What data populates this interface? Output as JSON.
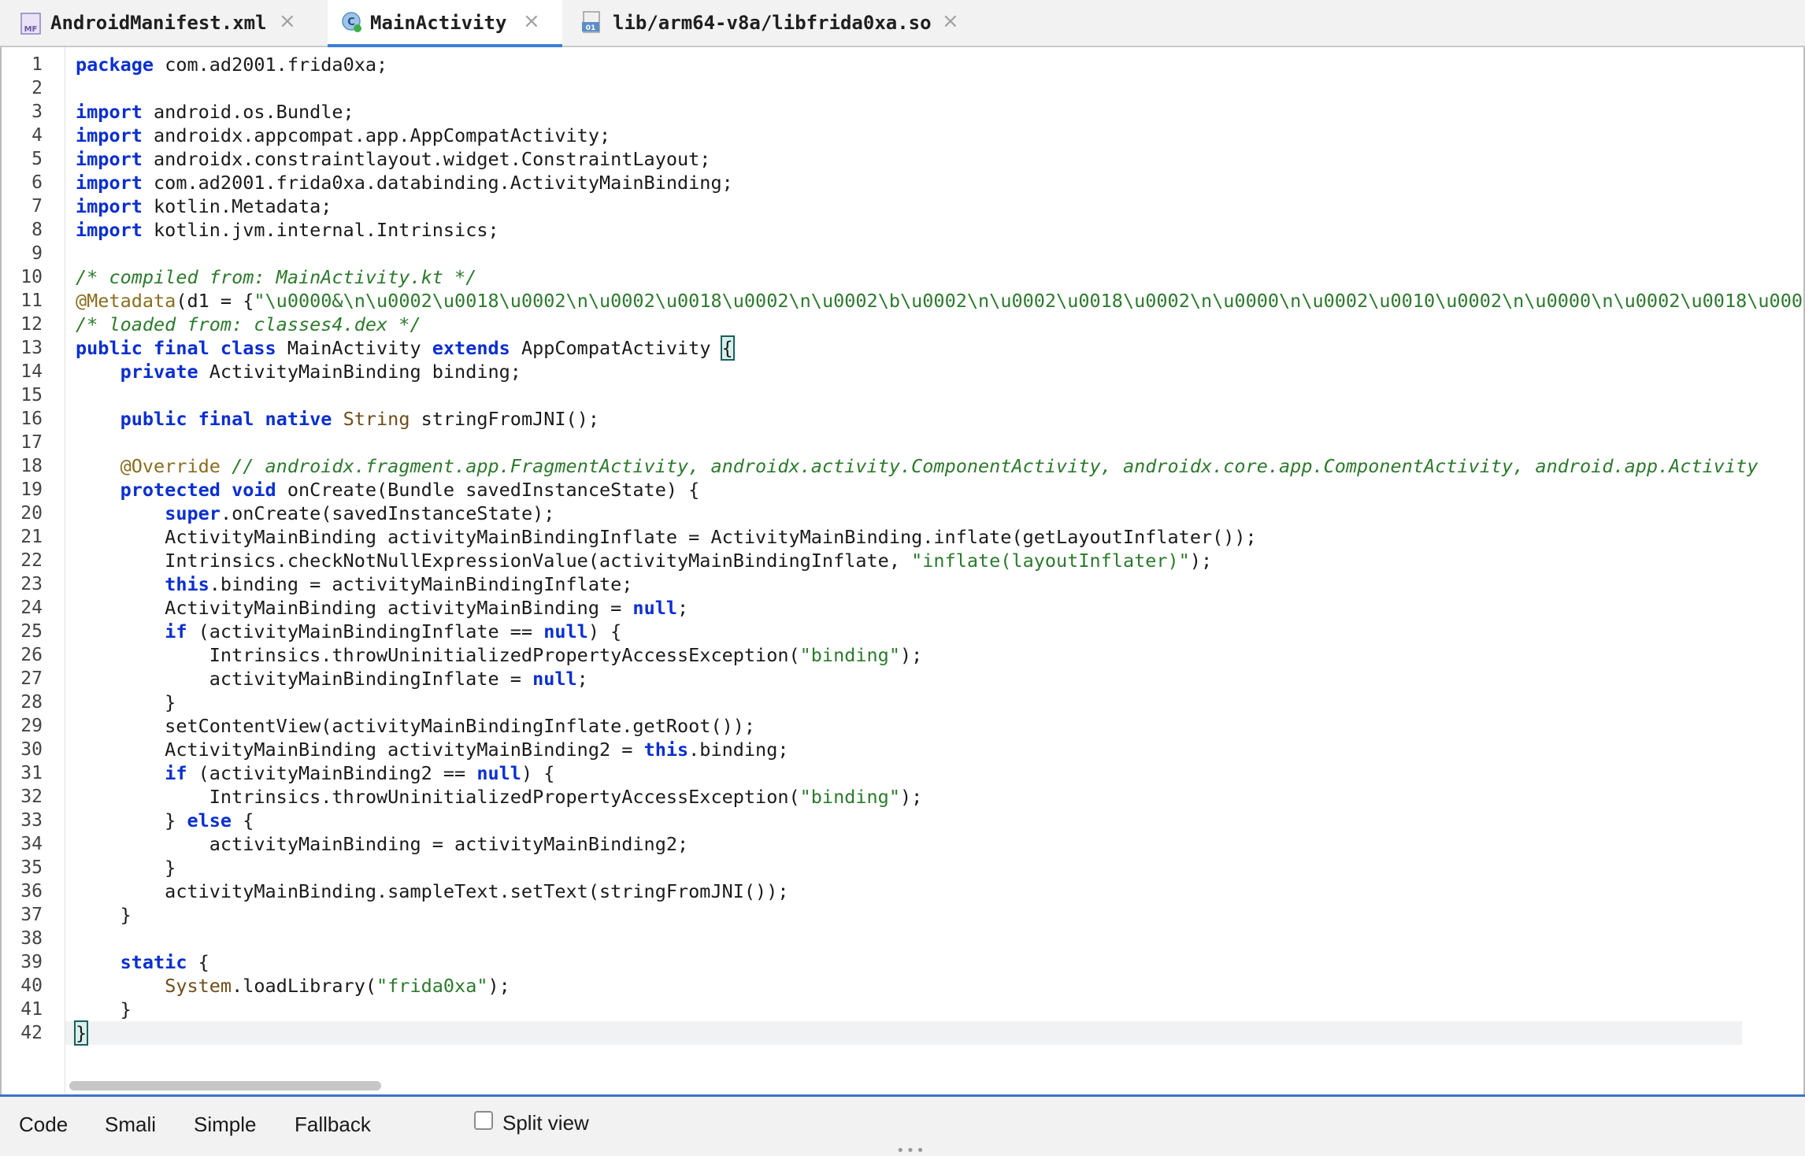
{
  "tabs": [
    {
      "label": "AndroidManifest.xml",
      "icon": "manifest-file-icon",
      "icon_text": "MF",
      "active": false
    },
    {
      "label": "MainActivity",
      "icon": "java-class-icon",
      "icon_text": "C",
      "active": true
    },
    {
      "label": "lib/arm64-v8a/libfrida0xa.so",
      "icon": "binary-file-icon",
      "icon_text": "01",
      "active": false
    }
  ],
  "close_glyph": "×",
  "line_numbers": [
    "1",
    "2",
    "3",
    "4",
    "5",
    "6",
    "7",
    "8",
    "9",
    "10",
    "11",
    "12",
    "13",
    "14",
    "15",
    "16",
    "17",
    "18",
    "19",
    "20",
    "21",
    "22",
    "23",
    "24",
    "25",
    "26",
    "27",
    "28",
    "29",
    "30",
    "31",
    "32",
    "33",
    "34",
    "35",
    "36",
    "37",
    "38",
    "39",
    "40",
    "41",
    "42"
  ],
  "code": [
    [
      {
        "t": "kw",
        "v": "package"
      },
      {
        "t": "p",
        "v": " com.ad2001.frida0xa;"
      }
    ],
    [],
    [
      {
        "t": "kw",
        "v": "import"
      },
      {
        "t": "p",
        "v": " android.os.Bundle;"
      }
    ],
    [
      {
        "t": "kw",
        "v": "import"
      },
      {
        "t": "p",
        "v": " androidx.appcompat.app.AppCompatActivity;"
      }
    ],
    [
      {
        "t": "kw",
        "v": "import"
      },
      {
        "t": "p",
        "v": " androidx.constraintlayout.widget.ConstraintLayout;"
      }
    ],
    [
      {
        "t": "kw",
        "v": "import"
      },
      {
        "t": "p",
        "v": " com.ad2001.frida0xa.databinding.ActivityMainBinding;"
      }
    ],
    [
      {
        "t": "kw",
        "v": "import"
      },
      {
        "t": "p",
        "v": " kotlin.Metadata;"
      }
    ],
    [
      {
        "t": "kw",
        "v": "import"
      },
      {
        "t": "p",
        "v": " kotlin.jvm.internal.Intrinsics;"
      }
    ],
    [],
    [
      {
        "t": "cm",
        "v": "/* compiled from: MainActivity.kt */"
      }
    ],
    [
      {
        "t": "ann",
        "v": "@Metadata"
      },
      {
        "t": "p",
        "v": "(d1 = {"
      },
      {
        "t": "str",
        "v": "\"\\u0000&\\n\\u0002\\u0018\\u0002\\n\\u0002\\u0018\\u0002\\n\\u0002\\b\\u0002\\n\\u0002\\u0018\\u0002\\n\\u0000\\n\\u0002\\u0010\\u0002\\n\\u0000\\n\\u0002\\u0018\\u0002\\n"
      }
    ],
    [
      {
        "t": "cm",
        "v": "/* loaded from: classes4.dex */"
      }
    ],
    [
      {
        "t": "kw",
        "v": "public final class"
      },
      {
        "t": "p",
        "v": " MainActivity "
      },
      {
        "t": "kw",
        "v": "extends"
      },
      {
        "t": "p",
        "v": " AppCompatActivity "
      },
      {
        "t": "hl",
        "v": "{"
      }
    ],
    [
      {
        "t": "p",
        "v": "    "
      },
      {
        "t": "kw",
        "v": "private"
      },
      {
        "t": "p",
        "v": " ActivityMainBinding binding;"
      }
    ],
    [],
    [
      {
        "t": "p",
        "v": "    "
      },
      {
        "t": "kw",
        "v": "public final native"
      },
      {
        "t": "p",
        "v": " "
      },
      {
        "t": "typ",
        "v": "String"
      },
      {
        "t": "p",
        "v": " stringFromJNI();"
      }
    ],
    [],
    [
      {
        "t": "p",
        "v": "    "
      },
      {
        "t": "ann",
        "v": "@Override"
      },
      {
        "t": "p",
        "v": " "
      },
      {
        "t": "cm",
        "v": "// androidx.fragment.app.FragmentActivity, androidx.activity.ComponentActivity, androidx.core.app.ComponentActivity, android.app.Activity"
      }
    ],
    [
      {
        "t": "p",
        "v": "    "
      },
      {
        "t": "kw",
        "v": "protected void"
      },
      {
        "t": "p",
        "v": " onCreate(Bundle savedInstanceState) {"
      }
    ],
    [
      {
        "t": "p",
        "v": "        "
      },
      {
        "t": "kw",
        "v": "super"
      },
      {
        "t": "p",
        "v": ".onCreate(savedInstanceState);"
      }
    ],
    [
      {
        "t": "p",
        "v": "        ActivityMainBinding activityMainBindingInflate = ActivityMainBinding.inflate(getLayoutInflater());"
      }
    ],
    [
      {
        "t": "p",
        "v": "        Intrinsics.checkNotNullExpressionValue(activityMainBindingInflate, "
      },
      {
        "t": "str",
        "v": "\"inflate(layoutInflater)\""
      },
      {
        "t": "p",
        "v": ");"
      }
    ],
    [
      {
        "t": "p",
        "v": "        "
      },
      {
        "t": "kw",
        "v": "this"
      },
      {
        "t": "p",
        "v": ".binding = activityMainBindingInflate;"
      }
    ],
    [
      {
        "t": "p",
        "v": "        ActivityMainBinding activityMainBinding = "
      },
      {
        "t": "kw",
        "v": "null"
      },
      {
        "t": "p",
        "v": ";"
      }
    ],
    [
      {
        "t": "p",
        "v": "        "
      },
      {
        "t": "kw",
        "v": "if"
      },
      {
        "t": "p",
        "v": " (activityMainBindingInflate == "
      },
      {
        "t": "kw",
        "v": "null"
      },
      {
        "t": "p",
        "v": ") {"
      }
    ],
    [
      {
        "t": "p",
        "v": "            Intrinsics.throwUninitializedPropertyAccessException("
      },
      {
        "t": "str",
        "v": "\"binding\""
      },
      {
        "t": "p",
        "v": ");"
      }
    ],
    [
      {
        "t": "p",
        "v": "            activityMainBindingInflate = "
      },
      {
        "t": "kw",
        "v": "null"
      },
      {
        "t": "p",
        "v": ";"
      }
    ],
    [
      {
        "t": "p",
        "v": "        }"
      }
    ],
    [
      {
        "t": "p",
        "v": "        setContentView(activityMainBindingInflate.getRoot());"
      }
    ],
    [
      {
        "t": "p",
        "v": "        ActivityMainBinding activityMainBinding2 = "
      },
      {
        "t": "kw",
        "v": "this"
      },
      {
        "t": "p",
        "v": ".binding;"
      }
    ],
    [
      {
        "t": "p",
        "v": "        "
      },
      {
        "t": "kw",
        "v": "if"
      },
      {
        "t": "p",
        "v": " (activityMainBinding2 == "
      },
      {
        "t": "kw",
        "v": "null"
      },
      {
        "t": "p",
        "v": ") {"
      }
    ],
    [
      {
        "t": "p",
        "v": "            Intrinsics.throwUninitializedPropertyAccessException("
      },
      {
        "t": "str",
        "v": "\"binding\""
      },
      {
        "t": "p",
        "v": ");"
      }
    ],
    [
      {
        "t": "p",
        "v": "        } "
      },
      {
        "t": "kw",
        "v": "else"
      },
      {
        "t": "p",
        "v": " {"
      }
    ],
    [
      {
        "t": "p",
        "v": "            activityMainBinding = activityMainBinding2;"
      }
    ],
    [
      {
        "t": "p",
        "v": "        }"
      }
    ],
    [
      {
        "t": "p",
        "v": "        activityMainBinding.sampleText.setText(stringFromJNI());"
      }
    ],
    [
      {
        "t": "p",
        "v": "    }"
      }
    ],
    [],
    [
      {
        "t": "p",
        "v": "    "
      },
      {
        "t": "kw",
        "v": "static"
      },
      {
        "t": "p",
        "v": " {"
      }
    ],
    [
      {
        "t": "p",
        "v": "        "
      },
      {
        "t": "typ",
        "v": "System"
      },
      {
        "t": "p",
        "v": ".loadLibrary("
      },
      {
        "t": "str",
        "v": "\"frida0xa\""
      },
      {
        "t": "p",
        "v": ");"
      }
    ],
    [
      {
        "t": "p",
        "v": "    }"
      }
    ],
    [
      {
        "t": "hl",
        "v": "}"
      }
    ]
  ],
  "current_line": 42,
  "bottom_tabs": {
    "code": "Code",
    "smali": "Smali",
    "simple": "Simple",
    "fallback": "Fallback"
  },
  "split_view": {
    "label": "Split view",
    "checked": false
  },
  "grip_glyph": "•••",
  "colors": {
    "accent": "#3d7fd6",
    "keyword": "#0a2fd0",
    "comment": "#2c7a2c",
    "annotation": "#8a6d1e"
  }
}
